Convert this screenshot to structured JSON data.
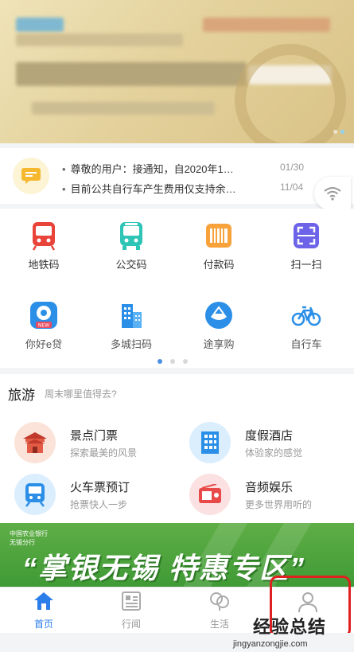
{
  "notice": {
    "items": [
      {
        "text": "尊敬的用户：接通知，自2020年1…",
        "date": "01/30"
      },
      {
        "text": "目前公共自行车产生费用仅支持余…",
        "date": "11/04"
      }
    ]
  },
  "grid": {
    "row1": [
      {
        "label": "地铁码",
        "icon": "metro-icon"
      },
      {
        "label": "公交码",
        "icon": "bus-icon"
      },
      {
        "label": "付款码",
        "icon": "payment-code-icon"
      },
      {
        "label": "扫一扫",
        "icon": "scan-icon"
      }
    ],
    "row2": [
      {
        "label": "你好e贷",
        "icon": "loan-icon",
        "badge": "NEW"
      },
      {
        "label": "多城扫码",
        "icon": "city-scan-icon"
      },
      {
        "label": "途享购",
        "icon": "shopping-icon"
      },
      {
        "label": "自行车",
        "icon": "bicycle-icon"
      }
    ]
  },
  "travel": {
    "title": "旅游",
    "subtitle": "周末哪里值得去?",
    "items": [
      {
        "name": "景点门票",
        "desc": "探索最美的风景",
        "icon": "attraction-icon"
      },
      {
        "name": "度假酒店",
        "desc": "体验家的感觉",
        "icon": "hotel-icon"
      },
      {
        "name": "火车票预订",
        "desc": "抢票快人一步",
        "icon": "train-icon"
      },
      {
        "name": "音频娱乐",
        "desc": "更多世界用听的",
        "icon": "radio-icon"
      }
    ]
  },
  "promo": {
    "bank": "中国农业银行",
    "branch": "无锡分行",
    "text": "“掌银无锡 特惠专区”"
  },
  "tabs": [
    {
      "label": "首页",
      "icon": "home-icon",
      "active": true
    },
    {
      "label": "行闻",
      "icon": "news-icon",
      "active": false
    },
    {
      "label": "生活",
      "icon": "life-icon",
      "active": false
    },
    {
      "label": "",
      "icon": "profile-icon",
      "active": false
    }
  ],
  "watermark": {
    "title": "经验总结",
    "url": "jingyanzongjie.com"
  },
  "colors": {
    "accent": "#2b7de9",
    "highlight": "#e02020",
    "promo_green": "#4aa63b"
  }
}
